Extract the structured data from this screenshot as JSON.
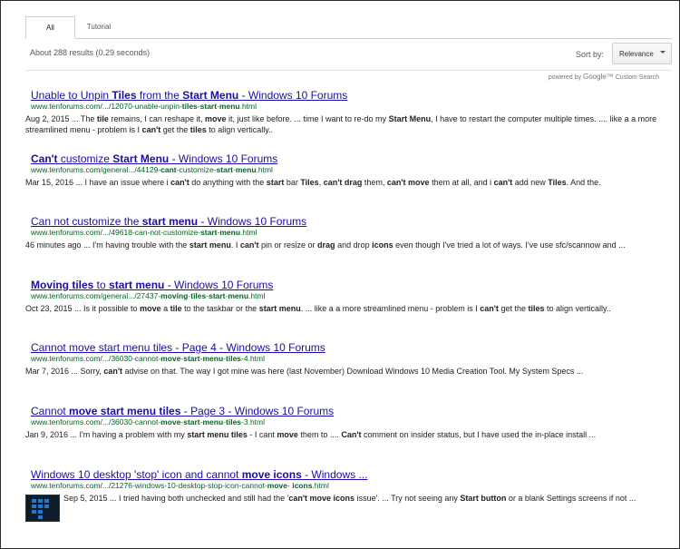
{
  "tabs": [
    {
      "label": "All",
      "active": true
    },
    {
      "label": "Tutorial",
      "active": false
    }
  ],
  "results_count": "About 288 results (0.29 seconds)",
  "sort": {
    "label": "Sort by:",
    "selected": "Relevance"
  },
  "powered_by": {
    "prefix": "powered by",
    "brand": "Google™",
    "suffix": "Custom Search"
  },
  "colors": {
    "link": "#1a0dab",
    "url": "#006621",
    "text": "#222222"
  },
  "results": [
    {
      "title": [
        {
          "t": "Unable to Unpin ",
          "b": false
        },
        {
          "t": "Tiles",
          "b": true
        },
        {
          "t": " from the ",
          "b": false
        },
        {
          "t": "Start Menu",
          "b": true
        },
        {
          "t": " - Windows 10 Forums",
          "b": false
        }
      ],
      "url": [
        {
          "t": "www.tenforums.com/.../12070-unable-unpin-",
          "b": false
        },
        {
          "t": "tiles",
          "b": true
        },
        {
          "t": "-",
          "b": false
        },
        {
          "t": "start",
          "b": true
        },
        {
          "t": "-",
          "b": false
        },
        {
          "t": "menu",
          "b": true
        },
        {
          "t": ".html",
          "b": false
        }
      ],
      "snippet": [
        {
          "t": "Aug 2, 2015 ... The ",
          "b": false
        },
        {
          "t": "tile",
          "b": true
        },
        {
          "t": " remains, I can reshape it, ",
          "b": false
        },
        {
          "t": "move",
          "b": true
        },
        {
          "t": " it, just like before. ... time I want to re-do my ",
          "b": false
        },
        {
          "t": "Start Menu",
          "b": true
        },
        {
          "t": ", I have to restart the computer multiple times. .... like a a more streamlined menu - problem is I ",
          "b": false
        },
        {
          "t": "can't",
          "b": true
        },
        {
          "t": " get the ",
          "b": false
        },
        {
          "t": "tiles",
          "b": true
        },
        {
          "t": " to align vertically..",
          "b": false
        }
      ]
    },
    {
      "title": [
        {
          "t": "Can't",
          "b": true
        },
        {
          "t": " customize ",
          "b": false
        },
        {
          "t": "Start Menu",
          "b": true
        },
        {
          "t": " - Windows 10 Forums",
          "b": false
        }
      ],
      "url": [
        {
          "t": "www.tenforums.com/general.../44129-",
          "b": false
        },
        {
          "t": "cant",
          "b": true
        },
        {
          "t": "-customize-",
          "b": false
        },
        {
          "t": "start",
          "b": true
        },
        {
          "t": "-",
          "b": false
        },
        {
          "t": "menu",
          "b": true
        },
        {
          "t": ".html",
          "b": false
        }
      ],
      "snippet": [
        {
          "t": "Mar 15, 2016 ... I have an issue where i ",
          "b": false
        },
        {
          "t": "can't",
          "b": true
        },
        {
          "t": " do anything with the ",
          "b": false
        },
        {
          "t": "start",
          "b": true
        },
        {
          "t": " bar ",
          "b": false
        },
        {
          "t": "Tiles",
          "b": true
        },
        {
          "t": ", ",
          "b": false
        },
        {
          "t": "can't drag",
          "b": true
        },
        {
          "t": " them, ",
          "b": false
        },
        {
          "t": "can't move",
          "b": true
        },
        {
          "t": " them at all, and i ",
          "b": false
        },
        {
          "t": "can't",
          "b": true
        },
        {
          "t": " add new ",
          "b": false
        },
        {
          "t": "Tiles",
          "b": true
        },
        {
          "t": ". And the.",
          "b": false
        }
      ]
    },
    {
      "title": [
        {
          "t": "Can not customize the ",
          "b": false
        },
        {
          "t": "start menu",
          "b": true
        },
        {
          "t": " - Windows 10 Forums",
          "b": false
        }
      ],
      "url": [
        {
          "t": "www.tenforums.com/.../49618-can-not-customize-",
          "b": false
        },
        {
          "t": "start",
          "b": true
        },
        {
          "t": "-",
          "b": false
        },
        {
          "t": "menu",
          "b": true
        },
        {
          "t": ".html",
          "b": false
        }
      ],
      "snippet": [
        {
          "t": "46 minutes ago ... I'm having trouble with the ",
          "b": false
        },
        {
          "t": "start menu",
          "b": true
        },
        {
          "t": ". I ",
          "b": false
        },
        {
          "t": "can't",
          "b": true
        },
        {
          "t": " pin or resize or ",
          "b": false
        },
        {
          "t": "drag",
          "b": true
        },
        {
          "t": " and drop ",
          "b": false
        },
        {
          "t": "icons",
          "b": true
        },
        {
          "t": " even though I've tried a lot of ways. I've use sfc/scannow and ...",
          "b": false
        }
      ]
    },
    {
      "title": [
        {
          "t": "Moving tiles",
          "b": true
        },
        {
          "t": " to ",
          "b": false
        },
        {
          "t": "start menu",
          "b": true
        },
        {
          "t": " - Windows 10 Forums",
          "b": false
        }
      ],
      "url": [
        {
          "t": "www.tenforums.com/general.../27437-",
          "b": false
        },
        {
          "t": "moving",
          "b": true
        },
        {
          "t": "-",
          "b": false
        },
        {
          "t": "tiles",
          "b": true
        },
        {
          "t": "-",
          "b": false
        },
        {
          "t": "start",
          "b": true
        },
        {
          "t": "-",
          "b": false
        },
        {
          "t": "menu",
          "b": true
        },
        {
          "t": ".html",
          "b": false
        }
      ],
      "snippet": [
        {
          "t": "Oct 23, 2015 ... Is it possible to ",
          "b": false
        },
        {
          "t": "move",
          "b": true
        },
        {
          "t": " a ",
          "b": false
        },
        {
          "t": "tile",
          "b": true
        },
        {
          "t": " to the taskbar or the ",
          "b": false
        },
        {
          "t": "start menu",
          "b": true
        },
        {
          "t": ". ... like a a more streamlined menu - problem is I ",
          "b": false
        },
        {
          "t": "can't",
          "b": true
        },
        {
          "t": " get the ",
          "b": false
        },
        {
          "t": "tiles",
          "b": true
        },
        {
          "t": " to align vertically..",
          "b": false
        }
      ]
    },
    {
      "title": [
        {
          "t": "Cannot move start menu tiles",
          "b": false
        },
        {
          "t": " - Page 4 - Windows 10 Forums",
          "b": false
        }
      ],
      "url": [
        {
          "t": "www.tenforums.com/.../36030-cannot-",
          "b": false
        },
        {
          "t": "move",
          "b": true
        },
        {
          "t": "-",
          "b": false
        },
        {
          "t": "start",
          "b": true
        },
        {
          "t": "-",
          "b": false
        },
        {
          "t": "menu",
          "b": true
        },
        {
          "t": "-",
          "b": false
        },
        {
          "t": "tiles",
          "b": true
        },
        {
          "t": "-4.html",
          "b": false
        }
      ],
      "snippet": [
        {
          "t": "Mar 7, 2016 ... Sorry, ",
          "b": false
        },
        {
          "t": "can't",
          "b": true
        },
        {
          "t": " advise on that. The way I got mine was here (last November) Download Windows 10 Media Creation Tool. My System Specs ...",
          "b": false
        }
      ]
    },
    {
      "title": [
        {
          "t": "Cannot ",
          "b": false
        },
        {
          "t": "move start menu tiles",
          "b": true
        },
        {
          "t": " - Page 3 - Windows 10 Forums",
          "b": false
        }
      ],
      "url": [
        {
          "t": "www.tenforums.com/.../36030-cannot-",
          "b": false
        },
        {
          "t": "move",
          "b": true
        },
        {
          "t": "-",
          "b": false
        },
        {
          "t": "start",
          "b": true
        },
        {
          "t": "-",
          "b": false
        },
        {
          "t": "menu",
          "b": true
        },
        {
          "t": "-",
          "b": false
        },
        {
          "t": "tiles",
          "b": true
        },
        {
          "t": "-3.html",
          "b": false
        }
      ],
      "snippet": [
        {
          "t": "Jan 9, 2016 ... I'm having a problem with my ",
          "b": false
        },
        {
          "t": "start menu tiles",
          "b": true
        },
        {
          "t": " - I cant ",
          "b": false
        },
        {
          "t": "move",
          "b": true
        },
        {
          "t": " them to .... ",
          "b": false
        },
        {
          "t": "Can't",
          "b": true
        },
        {
          "t": " comment on insider status, but I have used the in-place install ...",
          "b": false
        }
      ]
    },
    {
      "title": [
        {
          "t": "Windows 10 desktop 'stop' icon and cannot ",
          "b": false
        },
        {
          "t": "move icons",
          "b": true
        },
        {
          "t": " - Windows ...",
          "b": false
        }
      ],
      "url": [
        {
          "t": "www.tenforums.com/.../21276-windows-10-desktop-stop-icon-cannot-",
          "b": false
        },
        {
          "t": "move",
          "b": true
        },
        {
          "t": "- ",
          "b": false
        },
        {
          "t": "icons",
          "b": true
        },
        {
          "t": ".html",
          "b": false
        }
      ],
      "snippet": [
        {
          "t": "Sep 5, 2015 ... I tried having both unchecked and still had the '",
          "b": false
        },
        {
          "t": "can't move icons",
          "b": true
        },
        {
          "t": " issue'. ... Try not seeing any ",
          "b": false
        },
        {
          "t": "Start button",
          "b": true
        },
        {
          "t": " or a blank Settings screens if not ...",
          "b": false
        }
      ],
      "thumbnail_icon": "start-menu-thumbnail-icon"
    }
  ]
}
